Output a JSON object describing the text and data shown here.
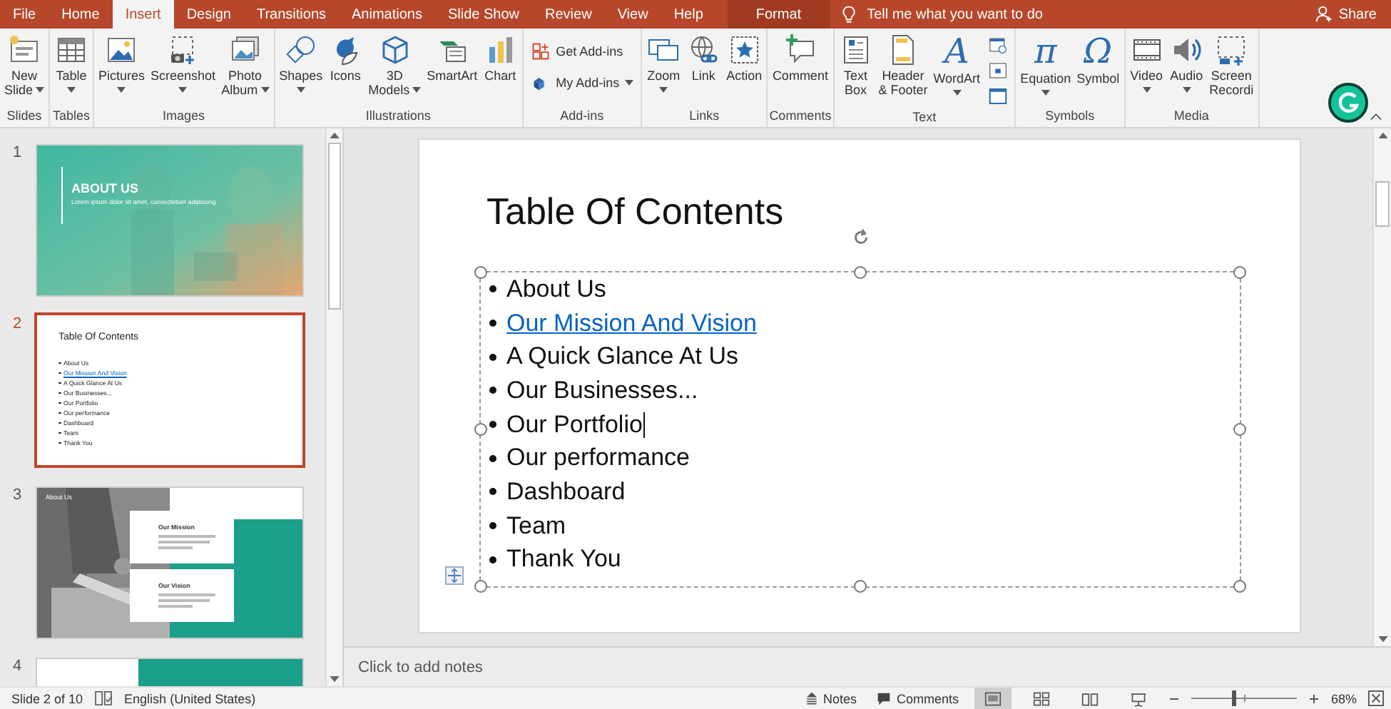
{
  "tabs": [
    {
      "label": "File",
      "selected": false
    },
    {
      "label": "Home",
      "selected": false
    },
    {
      "label": "Insert",
      "selected": true
    },
    {
      "label": "Design",
      "selected": false
    },
    {
      "label": "Transitions",
      "selected": false
    },
    {
      "label": "Animations",
      "selected": false
    },
    {
      "label": "Slide Show",
      "selected": false
    },
    {
      "label": "Review",
      "selected": false
    },
    {
      "label": "View",
      "selected": false
    },
    {
      "label": "Help",
      "selected": false
    }
  ],
  "context_tab": "Format",
  "tell_me": {
    "placeholder": "Tell me what you want to do"
  },
  "share": "Share",
  "ribbon": [
    {
      "label": "Slides",
      "buttons": [
        {
          "kind": "large",
          "lines": [
            "New",
            "Slide"
          ],
          "dropdown": true
        }
      ]
    },
    {
      "label": "Tables",
      "buttons": [
        {
          "kind": "large",
          "lines": [
            "Table"
          ],
          "dropdown": true
        }
      ]
    },
    {
      "label": "Images",
      "buttons": [
        {
          "kind": "large",
          "lines": [
            "Pictures"
          ],
          "dropdown": true
        },
        {
          "kind": "large",
          "lines": [
            "Screenshot"
          ],
          "dropdown": true
        },
        {
          "kind": "large",
          "lines": [
            "Photo",
            "Album"
          ],
          "dropdown": true
        }
      ]
    },
    {
      "label": "Illustrations",
      "buttons": [
        {
          "kind": "large",
          "lines": [
            "Shapes"
          ],
          "dropdown": true
        },
        {
          "kind": "large",
          "lines": [
            "Icons"
          ],
          "dropdown": false
        },
        {
          "kind": "large",
          "lines": [
            "3D",
            "Models"
          ],
          "dropdown": true
        },
        {
          "kind": "large",
          "lines": [
            "SmartArt"
          ],
          "dropdown": false
        },
        {
          "kind": "large",
          "lines": [
            "Chart"
          ],
          "dropdown": false
        }
      ]
    },
    {
      "label": "Add-ins",
      "buttons": [
        {
          "kind": "small",
          "lines": [
            "Get Add-ins"
          ],
          "dropdown": false
        },
        {
          "kind": "small",
          "lines": [
            "My Add-ins"
          ],
          "dropdown": true
        }
      ]
    },
    {
      "label": "Links",
      "buttons": [
        {
          "kind": "large",
          "lines": [
            "Zoom"
          ],
          "dropdown": true
        },
        {
          "kind": "large",
          "lines": [
            "Link"
          ],
          "dropdown": false
        },
        {
          "kind": "large",
          "lines": [
            "Action"
          ],
          "dropdown": false
        }
      ]
    },
    {
      "label": "Comments",
      "buttons": [
        {
          "kind": "large",
          "lines": [
            "Comment"
          ],
          "dropdown": false
        }
      ]
    },
    {
      "label": "Text",
      "buttons": [
        {
          "kind": "large",
          "lines": [
            "Text",
            "Box"
          ],
          "dropdown": false
        },
        {
          "kind": "large",
          "lines": [
            "Header",
            "& Footer"
          ],
          "dropdown": false
        },
        {
          "kind": "glyph",
          "glyph": "A",
          "lines": [
            "WordArt"
          ],
          "dropdown": true
        },
        {
          "kind": "stack"
        }
      ]
    },
    {
      "label": "Symbols",
      "buttons": [
        {
          "kind": "glyph",
          "glyph": "π",
          "lines": [
            "Equation"
          ],
          "dropdown": true
        },
        {
          "kind": "glyph",
          "glyph": "Ω",
          "lines": [
            "Symbol"
          ],
          "dropdown": false
        }
      ]
    },
    {
      "label": "Media",
      "buttons": [
        {
          "kind": "large",
          "lines": [
            "Video"
          ],
          "dropdown": true
        },
        {
          "kind": "large",
          "lines": [
            "Audio"
          ],
          "dropdown": true
        },
        {
          "kind": "large",
          "lines": [
            "Screen",
            "Recordi"
          ],
          "dropdown": false
        }
      ]
    }
  ],
  "thumbnails": [
    {
      "number": "1",
      "kind": "cover",
      "selected": false,
      "title": "ABOUT US",
      "subtitle": "Lorem ipsum dolor sit amet, consectetuer adipiscing"
    },
    {
      "number": "2",
      "kind": "contents",
      "selected": true,
      "title": "Table Of Contents",
      "items": [
        {
          "text": "About Us",
          "link": false
        },
        {
          "text": "Our Mission And Vision",
          "link": true
        },
        {
          "text": "A Quick Glance At Us",
          "link": false
        },
        {
          "text": "Our Businesses...",
          "link": false
        },
        {
          "text": "Our Portfolio",
          "link": false
        },
        {
          "text": "Our performance",
          "link": false
        },
        {
          "text": "Dashboard",
          "link": false
        },
        {
          "text": "Team",
          "link": false
        },
        {
          "text": "Thank You",
          "link": false
        }
      ]
    },
    {
      "number": "3",
      "kind": "cards",
      "selected": false,
      "label": "About Us",
      "cards": [
        "Our Mission",
        "Our Vision"
      ]
    },
    {
      "number": "4",
      "kind": "partial",
      "selected": false
    }
  ],
  "slide": {
    "title": "Table Of Contents",
    "items": [
      {
        "text": "About Us",
        "link": false,
        "cursor": false
      },
      {
        "text": "Our Mission And Vision",
        "link": true,
        "cursor": false
      },
      {
        "text": "A Quick Glance At Us",
        "link": false,
        "cursor": false
      },
      {
        "text": "Our Businesses...",
        "link": false,
        "cursor": false
      },
      {
        "text": "Our Portfolio",
        "link": false,
        "cursor": true
      },
      {
        "text": "Our performance",
        "link": false,
        "cursor": false
      },
      {
        "text": "Dashboard",
        "link": false,
        "cursor": false
      },
      {
        "text": "Team",
        "link": false,
        "cursor": false
      },
      {
        "text": "Thank You",
        "link": false,
        "cursor": false
      }
    ]
  },
  "notes": {
    "placeholder": "Click to add notes"
  },
  "status": {
    "slide": "Slide 2 of 10",
    "language": "English (United States)",
    "notes": "Notes",
    "comments": "Comments",
    "views": [
      {
        "kind": "normal",
        "selected": true
      },
      {
        "kind": "sorter",
        "selected": false
      },
      {
        "kind": "reading",
        "selected": false
      },
      {
        "kind": "show",
        "selected": false
      }
    ],
    "zoom": {
      "level": 0.4,
      "reading": "68%"
    }
  }
}
